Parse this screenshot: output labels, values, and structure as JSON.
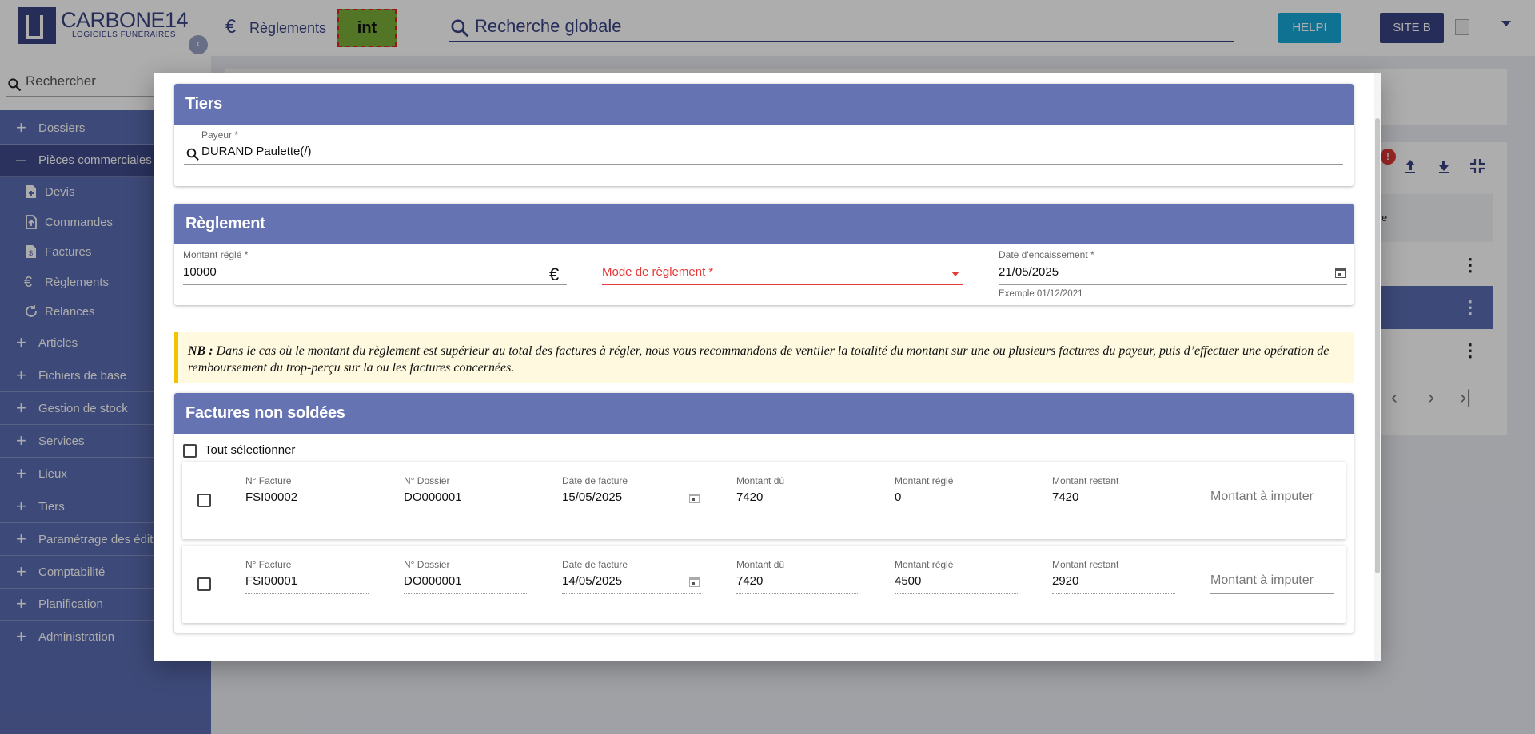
{
  "app": {
    "brand": "CARBONE14",
    "tagline": "LOGICIELS FUNÉRAIRES",
    "search_placeholder": "Rechercher"
  },
  "sidebar": {
    "items": [
      {
        "label": "Dossiers"
      },
      {
        "label": "Pièces commerciales"
      },
      {
        "label": "Articles"
      },
      {
        "label": "Fichiers de base"
      },
      {
        "label": "Gestion de stock"
      },
      {
        "label": "Services"
      },
      {
        "label": "Lieux"
      },
      {
        "label": "Tiers"
      },
      {
        "label": "Paramétrage des éditions"
      },
      {
        "label": "Comptabilité"
      },
      {
        "label": "Planification"
      },
      {
        "label": "Administration"
      }
    ],
    "subitems": [
      {
        "label": "Devis"
      },
      {
        "label": "Commandes"
      },
      {
        "label": "Factures"
      },
      {
        "label": "Règlements"
      },
      {
        "label": "Relances"
      }
    ]
  },
  "topbar": {
    "page_title": "Règlements",
    "env_badge": "int",
    "global_search": "Recherche globale",
    "help_label": "HELPI",
    "site_label": "SITE B"
  },
  "background": {
    "header_fragment": "e",
    "badge": "!"
  },
  "modal": {
    "tiers": {
      "title": "Tiers",
      "payeur_label": "Payeur *",
      "payeur_value": "DURAND Paulette(/)"
    },
    "reglement": {
      "title": "Règlement",
      "montant_label": "Montant réglé *",
      "montant_value": "10000",
      "currency": "€",
      "mode_label": "Mode de règlement *",
      "date_label": "Date d'encaissement *",
      "date_value": "21/05/2025",
      "date_hint": "Exemple 01/12/2021"
    },
    "note": {
      "prefix": "NB :",
      "text": "Dans le cas où le montant du règlement est supérieur au total des factures à régler, nous vous recommandons de ventiler la totalité du montant sur une ou plusieurs factures du payeur, puis d’effectuer une opération de remboursement du trop-perçu sur la ou les factures concernées."
    },
    "factures": {
      "title": "Factures non soldées",
      "select_all_label": "Tout sélectionner",
      "columns": [
        "N° Facture",
        "N° Dossier",
        "Date de facture",
        "Montant dû",
        "Montant réglé",
        "Montant restant"
      ],
      "imputer_placeholder": "Montant à imputer",
      "rows": [
        {
          "facture": "FSI00002",
          "dossier": "DO000001",
          "date": "15/05/2025",
          "du": "7420",
          "regle": "0",
          "restant": "7420"
        },
        {
          "facture": "FSI00001",
          "dossier": "DO000001",
          "date": "14/05/2025",
          "du": "7420",
          "regle": "4500",
          "restant": "2920"
        }
      ]
    }
  },
  "colors": {
    "sidebar": "#5b6cb1",
    "section_header": "#6573b2",
    "brand_dark": "#3a4384",
    "help_button": "#19a9d8",
    "env_badge": "#7aad39",
    "required_red": "#e53935",
    "note_background": "#fff9e0",
    "note_border": "#f3c200"
  },
  "icons": [
    "search-icon",
    "euro-icon",
    "calendar-icon",
    "chevron-left-icon",
    "plus-icon",
    "upload-icon",
    "download-icon",
    "collapse-icon",
    "more-vert-icon",
    "dropdown-arrow-icon"
  ]
}
